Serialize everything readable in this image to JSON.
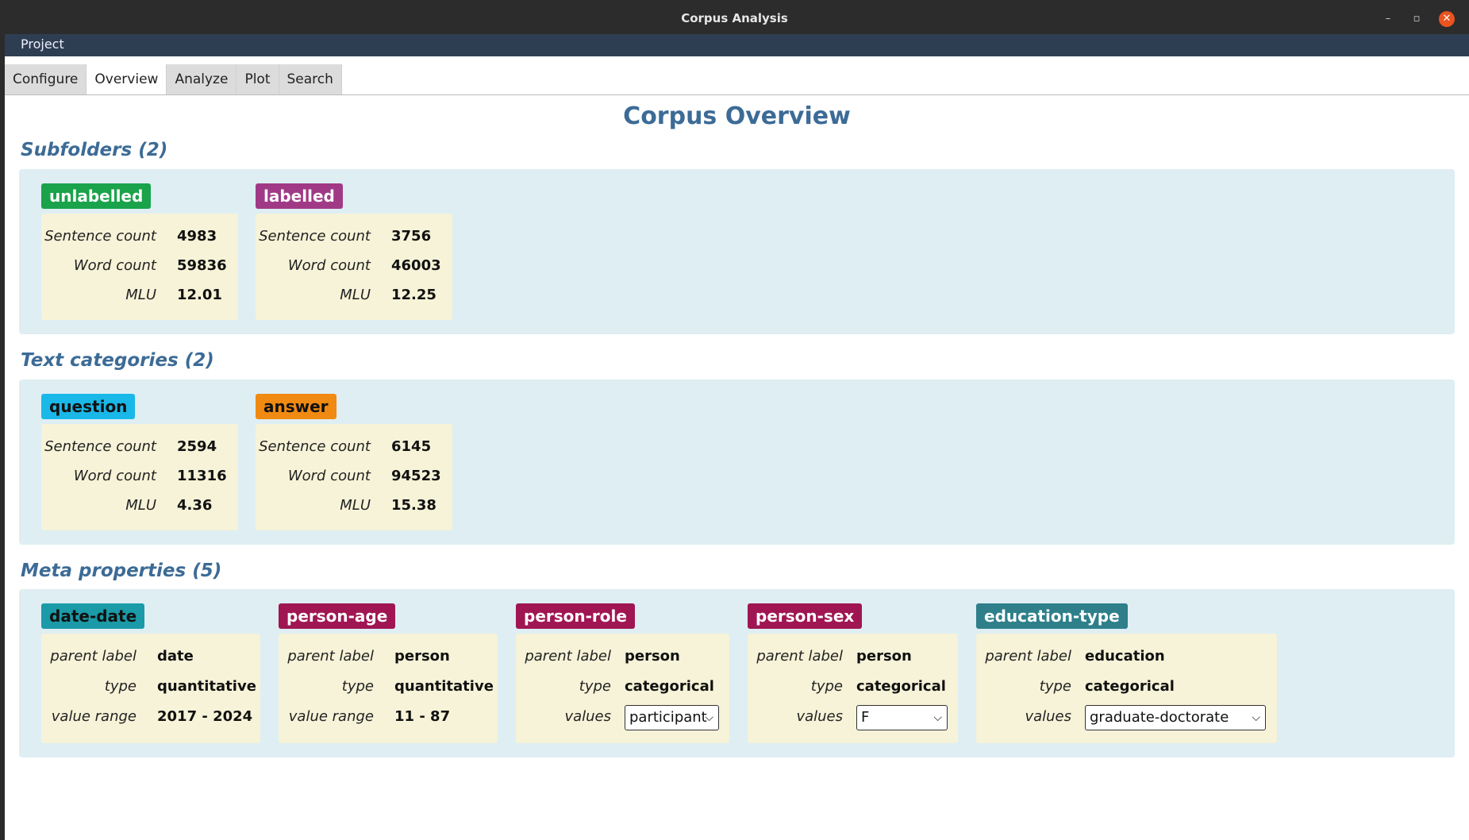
{
  "window": {
    "title": "Corpus Analysis"
  },
  "menu": {
    "project": "Project"
  },
  "tabs": [
    "Configure",
    "Overview",
    "Analyze",
    "Plot",
    "Search"
  ],
  "page_title": "Corpus Overview",
  "sections": {
    "subfolders": {
      "title": "Subfolders (2)",
      "cards": [
        {
          "tag": "unlabelled",
          "color": "#1aa34a",
          "rows": [
            [
              "Sentence count",
              "4983"
            ],
            [
              "Word count",
              "59836"
            ],
            [
              "MLU",
              "12.01"
            ]
          ]
        },
        {
          "tag": "labelled",
          "color": "#a03a86",
          "rows": [
            [
              "Sentence count",
              "3756"
            ],
            [
              "Word count",
              "46003"
            ],
            [
              "MLU",
              "12.25"
            ]
          ]
        }
      ]
    },
    "text_categories": {
      "title": "Text categories (2)",
      "cards": [
        {
          "tag": "question",
          "color": "#1ab8e8",
          "textcolor": "#111",
          "rows": [
            [
              "Sentence count",
              "2594"
            ],
            [
              "Word count",
              "11316"
            ],
            [
              "MLU",
              "4.36"
            ]
          ]
        },
        {
          "tag": "answer",
          "color": "#f08a12",
          "textcolor": "#111",
          "rows": [
            [
              "Sentence count",
              "6145"
            ],
            [
              "Word count",
              "94523"
            ],
            [
              "MLU",
              "15.38"
            ]
          ]
        }
      ]
    },
    "meta_properties": {
      "title": "Meta properties (5)",
      "cards": [
        {
          "tag": "date-date",
          "color": "#1b9aa8",
          "textcolor": "#111",
          "parent_label": "date",
          "type": "quantitative",
          "value_label": "value range",
          "value": "2017 - 2024"
        },
        {
          "tag": "person-age",
          "color": "#a01653",
          "parent_label": "person",
          "type": "quantitative",
          "value_label": "value range",
          "value": "11 - 87"
        },
        {
          "tag": "person-role",
          "color": "#a01653",
          "parent_label": "person",
          "type": "categorical",
          "value_label": "values",
          "select": "participant"
        },
        {
          "tag": "person-sex",
          "color": "#a01653",
          "parent_label": "person",
          "type": "categorical",
          "value_label": "values",
          "select": "F"
        },
        {
          "tag": "education-type",
          "color": "#2e7f8a",
          "parent_label": "education",
          "type": "categorical",
          "value_label": "values",
          "select": "graduate-doctorate"
        }
      ],
      "labels": {
        "parent_label": "parent label",
        "type": "type"
      }
    }
  }
}
